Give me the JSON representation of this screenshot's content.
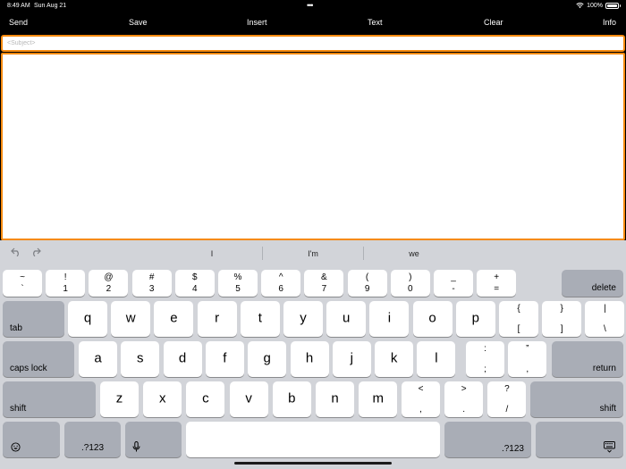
{
  "status": {
    "time": "8:49 AM",
    "date": "Sun Aug 21",
    "battery": "100%",
    "battery_level": 1.0
  },
  "toolbar": {
    "send": "Send",
    "save": "Save",
    "insert": "Insert",
    "text": "Text",
    "clear": "Clear",
    "info": "Info"
  },
  "subject": {
    "placeholder": "<Subject>",
    "value": ""
  },
  "body": {
    "value": ""
  },
  "suggestions": [
    "I",
    "I'm",
    "we"
  ],
  "keys": {
    "row1": [
      {
        "top": "~",
        "bot": "`"
      },
      {
        "top": "!",
        "bot": "1"
      },
      {
        "top": "@",
        "bot": "2"
      },
      {
        "top": "#",
        "bot": "3"
      },
      {
        "top": "$",
        "bot": "4"
      },
      {
        "top": "%",
        "bot": "5"
      },
      {
        "top": "^",
        "bot": "6"
      },
      {
        "top": "&",
        "bot": "7"
      },
      {
        "top": "(",
        "bot": "9"
      },
      {
        "top": ")",
        "bot": "0"
      },
      {
        "top": "_",
        "bot": "-"
      },
      {
        "top": "+",
        "bot": "="
      }
    ],
    "row1_note": "",
    "delete": "delete",
    "tab": "tab",
    "row2": [
      "q",
      "w",
      "e",
      "r",
      "t",
      "y",
      "u",
      "i",
      "o",
      "p"
    ],
    "row2_sym": [
      {
        "top": "{",
        "bot": "["
      },
      {
        "top": "}",
        "bot": "]"
      },
      {
        "top": "|",
        "bot": "\\"
      }
    ],
    "caps": "caps lock",
    "row3": [
      "a",
      "s",
      "d",
      "f",
      "g",
      "h",
      "j",
      "k",
      "l"
    ],
    "row3_sym": [
      {
        "top": ":",
        "bot": ";"
      },
      {
        "top": "”",
        "bot": ","
      }
    ],
    "return": "return",
    "shift": "shift",
    "row4": [
      "z",
      "x",
      "c",
      "v",
      "b",
      "n",
      "m"
    ],
    "row4_sym": [
      {
        "top": "<",
        "bot": ","
      },
      {
        "top": ">",
        "bot": "."
      },
      {
        "top": "?",
        "bot": "/"
      }
    ],
    "num": ".?123"
  }
}
